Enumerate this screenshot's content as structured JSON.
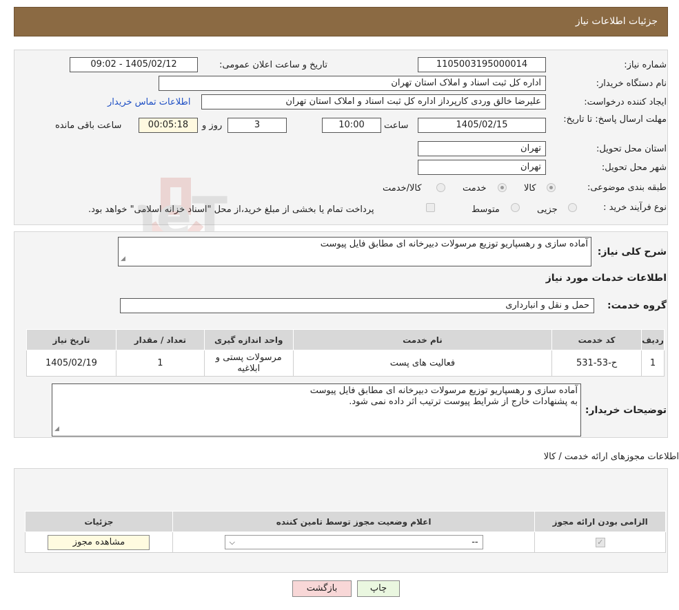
{
  "header": {
    "title": "جزئیات اطلاعات نیاز"
  },
  "form": {
    "need_number_label": "شماره نیاز:",
    "need_number": "1105003195000014",
    "announce_label": "تاریخ و ساعت اعلان عمومی:",
    "announce_value": "1405/02/12 - 09:02",
    "buyer_label": "نام دستگاه خریدار:",
    "buyer_value": "اداره کل ثبت اسناد و املاک استان تهران",
    "creator_label": "ایجاد کننده درخواست:",
    "creator_value": "علیرضا خالق وردی کارپرداز اداره کل ثبت اسناد و املاک استان تهران",
    "contact_link": "اطلاعات تماس خریدار",
    "deadline_label": "مهلت ارسال پاسخ: تا تاریخ:",
    "deadline_date": "1405/02/15",
    "time_label": "ساعت",
    "deadline_time": "10:00",
    "days_value": "3",
    "days_label": "روز و",
    "remaining_value": "00:05:18",
    "remaining_label": "ساعت باقی مانده",
    "province_label": "استان محل تحویل:",
    "province_value": "تهران",
    "city_label": "شهر محل تحویل:",
    "city_value": "تهران",
    "category_label": "طبقه بندی موضوعی:",
    "category_options": [
      "کالا",
      "خدمت",
      "کالا/خدمت"
    ],
    "purchase_type_label": "نوع فرآیند خرید :",
    "purchase_options": [
      "جزیی",
      "متوسط"
    ],
    "purchase_note": "پرداخت تمام یا بخشی از مبلغ خرید،از محل \"اسناد خزانه اسلامی\" خواهد بود.",
    "summary_label": "شرح کلی نیاز:",
    "summary_value": "آماده سازی و رهسپاریو توزیع مرسولات دبیرخانه ای مطابق فایل پیوست",
    "services_heading": "اطلاعات خدمات مورد نیاز",
    "service_group_label": "گروه خدمت:",
    "service_group_value": "حمل و نقل و انبارداری",
    "notes_label": "توضیحات خریدار:",
    "notes_line1": "آماده سازی و رهسپاریو توزیع مرسولات دبیرخانه ای مطابق فایل پیوست",
    "notes_line2": "به پشنهادات خارج از شرایط پیوست ترتیب اثر داده نمی شود."
  },
  "services_table": {
    "headers": [
      "ردیف",
      "کد خدمت",
      "نام خدمت",
      "واحد اندازه گیری",
      "تعداد / مقدار",
      "تاریخ نیاز"
    ],
    "rows": [
      [
        "1",
        "ح-53-531",
        "فعالیت های پست",
        "مرسولات پستی و ابلاغیه",
        "1",
        "1405/02/19"
      ]
    ]
  },
  "licenses": {
    "heading": "اطلاعات مجوزهای ارائه خدمت / کالا",
    "headers": [
      "الزامی بودن ارائه مجوز",
      "اعلام وضعیت مجوز توسط تامین کننده",
      "جزئیات"
    ],
    "select_value": "--",
    "view_button": "مشاهده مجوز"
  },
  "buttons": {
    "print": "چاپ",
    "back": "بازگشت"
  },
  "watermark": {
    "text": "AriaTender.neT"
  },
  "colors": {
    "header_bg": "#8b6a43",
    "link": "#1e4fc4",
    "back_btn": "#f8d7d7",
    "print_btn": "#eaf7e0"
  }
}
